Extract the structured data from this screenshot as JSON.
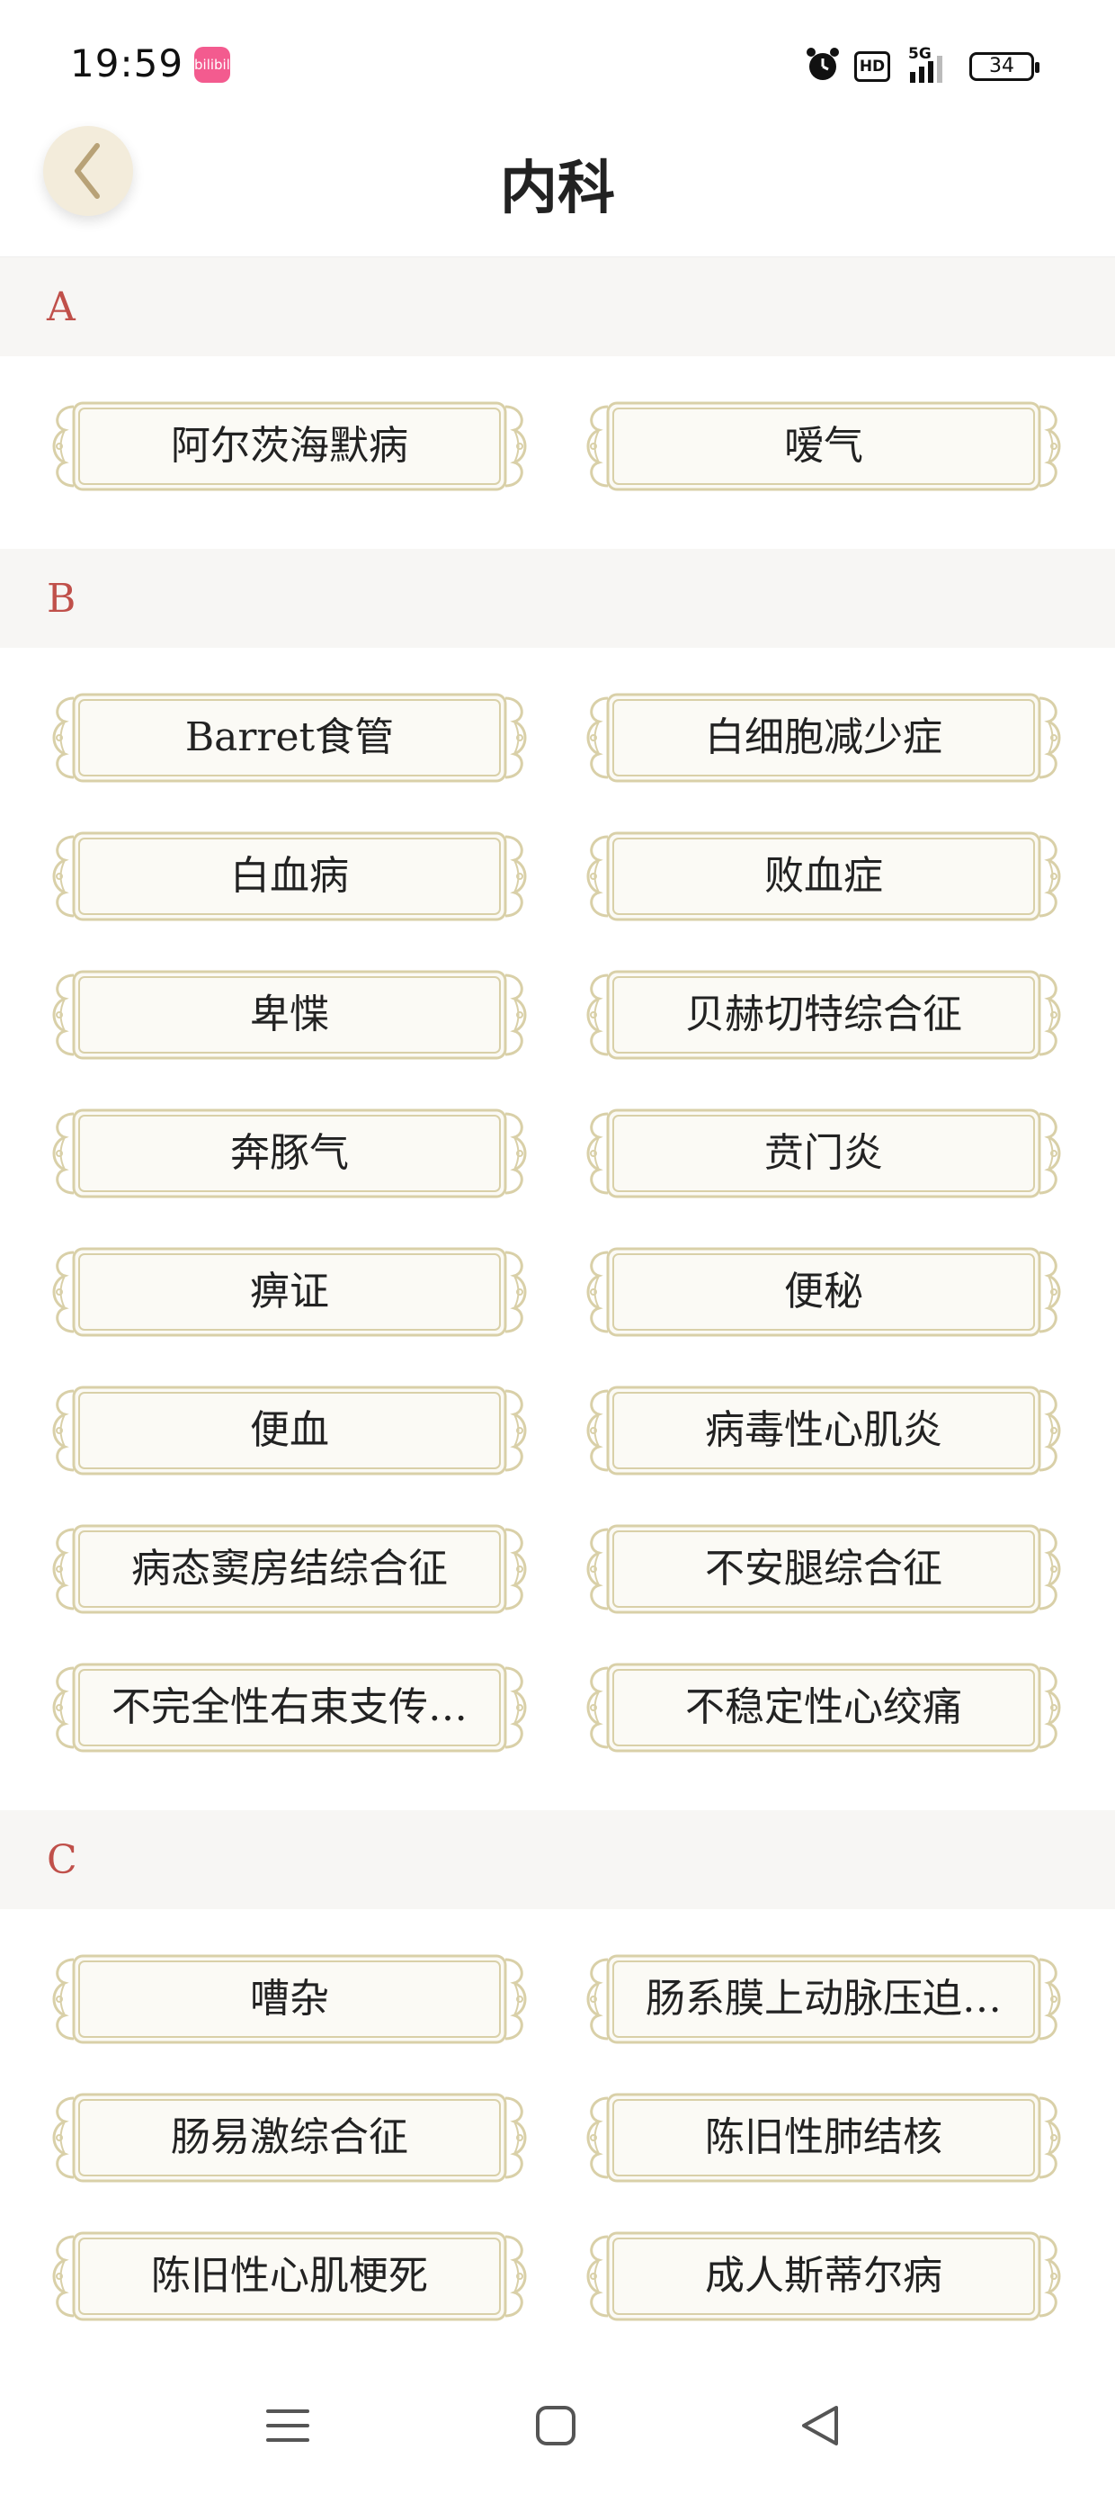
{
  "status_bar": {
    "time": "19:59",
    "app_badge": "bilibili",
    "hd_label": "HD",
    "network_label": "5G",
    "battery_level": "34"
  },
  "header": {
    "title": "内科"
  },
  "sections": [
    {
      "letter": "A",
      "items": [
        "阿尔茨海默病",
        "嗳气"
      ]
    },
    {
      "letter": "B",
      "items": [
        "Barret食管",
        "白细胞减少症",
        "白血病",
        "败血症",
        "卑惵",
        "贝赫切特综合征",
        "奔豚气",
        "贲门炎",
        "痹证",
        "便秘",
        "便血",
        "病毒性心肌炎",
        "病态窦房结综合征",
        "不安腿综合征",
        "不完全性右束支传…",
        "不稳定性心绞痛"
      ]
    },
    {
      "letter": "C",
      "items": [
        "嘈杂",
        "肠系膜上动脉压迫…",
        "肠易激综合征",
        "陈旧性肺结核",
        "陈旧性心肌梗死",
        "成人斯蒂尔病"
      ]
    }
  ],
  "icons": {
    "back": "chevron-left-icon",
    "alarm": "alarm-clock-icon",
    "signal": "signal-bars-icon",
    "nav_menu": "menu-icon",
    "nav_home": "home-square-icon",
    "nav_back": "back-triangle-icon"
  },
  "colors": {
    "accent_letter": "#c0504a",
    "plaque_border": "#d9d0a8",
    "plaque_fill": "#fbfaf5",
    "section_bg": "#f7f6f4",
    "back_button_bg": "#f3ecdb",
    "back_chevron": "#b8a277"
  }
}
